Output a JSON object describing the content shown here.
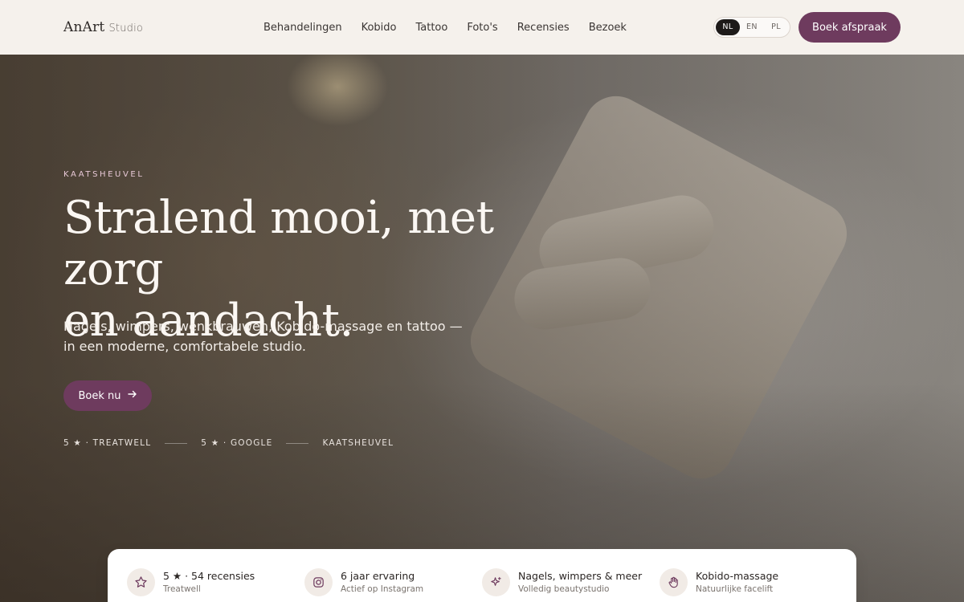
{
  "header": {
    "logo": "AnArt",
    "logo_suffix": "Studio",
    "nav": [
      "Behandelingen",
      "Kobido",
      "Tattoo",
      "Foto's",
      "Recensies",
      "Bezoek"
    ],
    "languages": [
      "NL",
      "EN",
      "PL"
    ],
    "active_language": "NL",
    "book_label": "Boek afspraak"
  },
  "hero": {
    "eyebrow": "KAATSHEUVEL",
    "title_line1": "Stralend mooi, met zorg",
    "title_line2": "en aandacht.",
    "subtitle": "Nagels, wimpers, wenkbrauwen, Kobido-massage en tattoo — in een moderne, comfortabele studio.",
    "cta_label": "Boek nu",
    "proof": [
      "5 ★ · TREATWELL",
      "5 ★ · GOOGLE",
      "KAATSHEUVEL"
    ]
  },
  "features": [
    {
      "title": "5 ★ · 54 recensies",
      "subtitle": "Treatwell",
      "icon": "star-icon"
    },
    {
      "title": "6 jaar ervaring",
      "subtitle": "Actief op Instagram",
      "icon": "instagram-icon"
    },
    {
      "title": "Nagels, wimpers & meer",
      "subtitle": "Volledig beautystudio",
      "icon": "sparkle-icon"
    },
    {
      "title": "Kobido-massage",
      "subtitle": "Natuurlijke facelift",
      "icon": "hand-icon"
    }
  ],
  "colors": {
    "accent": "#6e3b5e",
    "background": "#f5f1ec",
    "eyebrow": "#e7c8d6"
  }
}
